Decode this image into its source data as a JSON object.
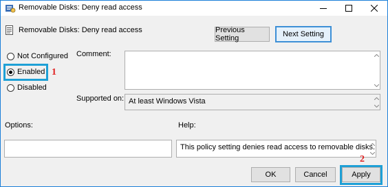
{
  "window": {
    "title": "Removable Disks: Deny read access",
    "controls": {
      "minimize": "minimize-icon",
      "maximize": "maximize-icon",
      "close": "close-icon"
    }
  },
  "header": {
    "policy_name": "Removable Disks: Deny read access",
    "prev_setting_label": "Previous Setting",
    "next_setting_label": "Next Setting"
  },
  "state": {
    "options": [
      {
        "label": "Not Configured",
        "selected": false
      },
      {
        "label": "Enabled",
        "selected": true
      },
      {
        "label": "Disabled",
        "selected": false
      }
    ]
  },
  "fields": {
    "comment_label": "Comment:",
    "comment_value": "",
    "supported_label": "Supported on:",
    "supported_value": "At least Windows Vista",
    "options_label": "Options:",
    "help_label": "Help:",
    "help_text": "This policy setting denies read access to removable disks."
  },
  "footer": {
    "ok_label": "OK",
    "cancel_label": "Cancel",
    "apply_label": "Apply"
  },
  "annotations": {
    "marker_1": "1",
    "marker_2": "2",
    "highlight_color": "#1ea0d6",
    "marker_color": "#e02020"
  }
}
